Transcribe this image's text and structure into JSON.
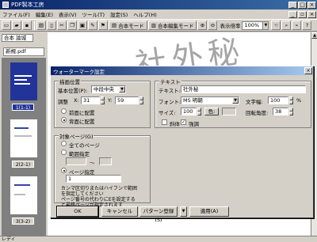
{
  "app": {
    "title": "PDF製本工房"
  },
  "menu": [
    "ファイル(F)",
    "編集(E)",
    "表示(V)",
    "ツール(T)",
    "設定(S)",
    "ヘルプ(H)"
  ],
  "toolbar": {
    "mode1": "合本モード",
    "mode2": "合本編集モード",
    "zoom_label": "表示倍率",
    "zoom_value": "100%"
  },
  "left": {
    "doc_label": "合本 論城",
    "file_tab": "新規.pdf",
    "thumbs": [
      "1(1-1)",
      "2(2-1)",
      "3(3-2)"
    ]
  },
  "watermark_text": "社外秘",
  "status": "レディ",
  "dialog": {
    "title": "ウォーターマーク設定",
    "position_group": "描画位置",
    "base_pos_label": "基本位置(P):",
    "base_pos_value": "中段中央",
    "adjust_label": "調整",
    "x_label": "X:",
    "x_value": "31",
    "y_label": "Y:",
    "y_value": "59",
    "front_label": "前面に配置",
    "back_label": "背面に配置",
    "text_group": "テキスト",
    "text_label": "テキスト:",
    "text_value": "社外秘",
    "font_label": "フォント:",
    "font_value": "MS 明朝",
    "size_label": "サイズ:",
    "size_value": "100",
    "color_label": "色:",
    "spacing_label": "文字幅:",
    "spacing_value": "100",
    "spacing_unit": "%",
    "rotation_label": "回転角度:",
    "rotation_value": "38",
    "italic_label": "斜体",
    "bold_label": "強調",
    "pages_group": "対象ページ(G)",
    "all_pages": "全てのページ",
    "range_pages": "範囲指定",
    "range_sep": "〜",
    "page_spec": "ページ指定",
    "page_spec_value": "1",
    "help_lines": [
      "カンマ区切りまたはハイフンで範囲",
      "を指定してください",
      "ページ番号の代わりにEを設定する",
      "と最終ページが指定されます"
    ],
    "ok": "OK",
    "cancel": "キャンセル",
    "pattern": "パターン登録(S)",
    "apply": "適用(A)"
  }
}
